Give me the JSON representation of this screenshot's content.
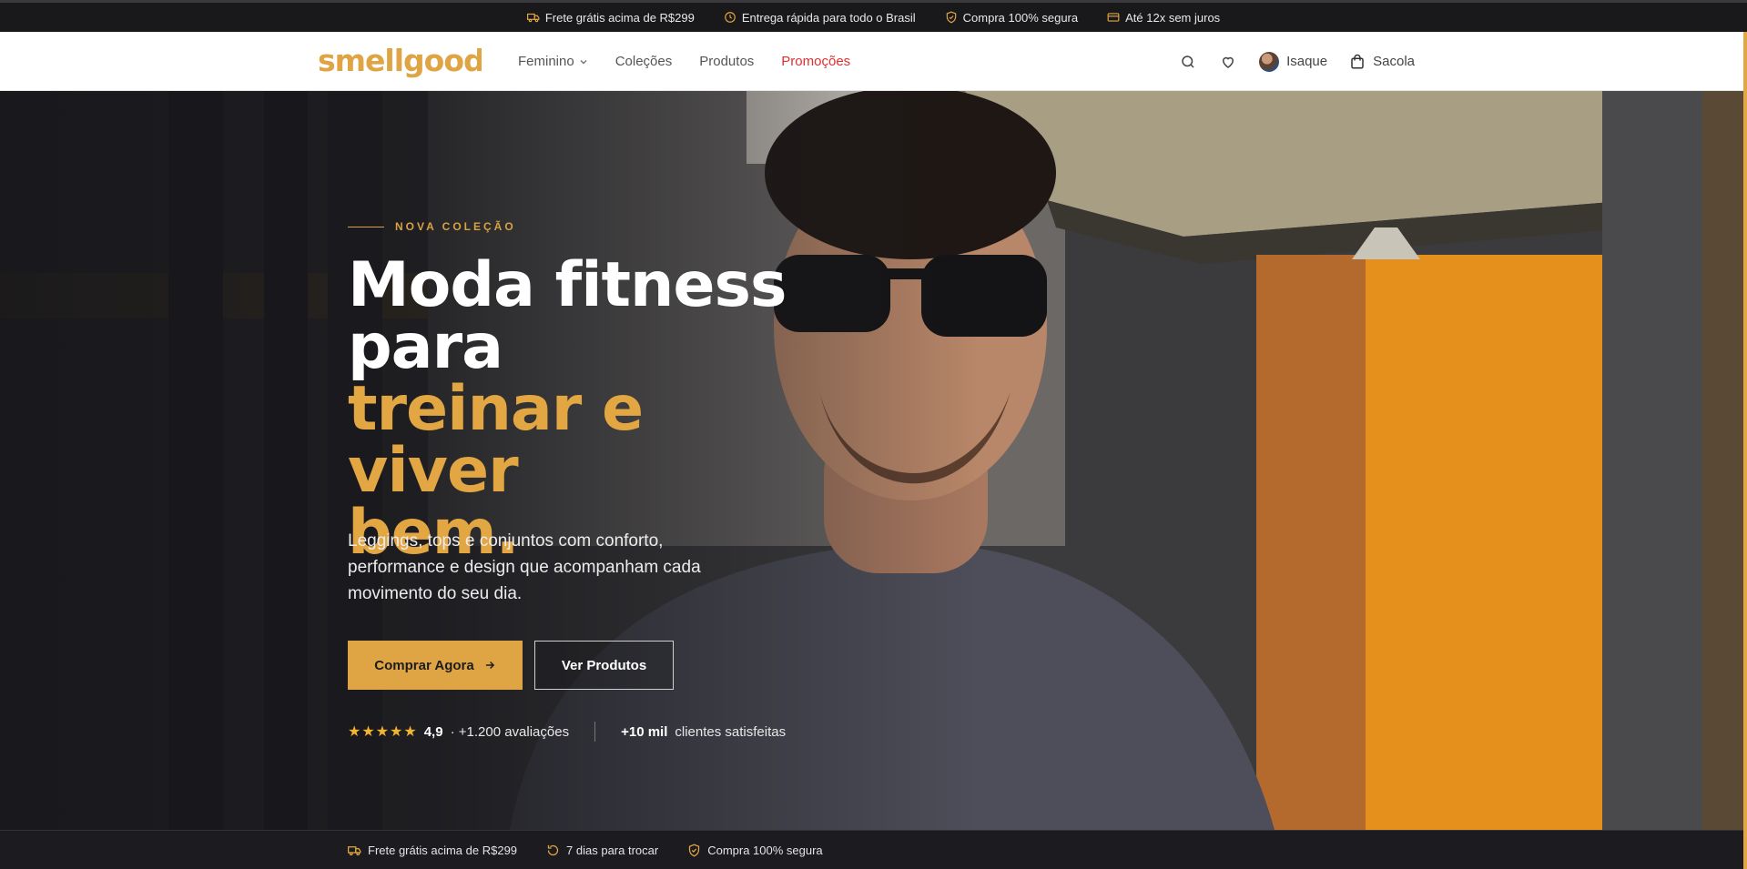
{
  "topbar": {
    "items": [
      {
        "icon": "truck-icon",
        "text": "Frete grátis acima de R$299"
      },
      {
        "icon": "clock-icon",
        "text": "Entrega rápida para todo o Brasil"
      },
      {
        "icon": "shield-check-icon",
        "text": "Compra 100% segura"
      },
      {
        "icon": "credit-card-icon",
        "text": "Até 12x sem juros"
      }
    ]
  },
  "header": {
    "logo_text": "smellgood",
    "nav": [
      {
        "label": "Feminino",
        "has_dropdown": true
      },
      {
        "label": "Coleções"
      },
      {
        "label": "Produtos"
      },
      {
        "label": "Promoções",
        "highlight_color": "#e0302f"
      }
    ],
    "user_name": "Isaque",
    "bag_label": "Sacola"
  },
  "hero": {
    "eyebrow": "NOVA COLEÇÃO",
    "headline_line1": "Moda fitness",
    "headline_line2": "para",
    "headline_line3": "treinar e viver",
    "headline_line4": "bem.",
    "subtitle": "Leggings, tops e conjuntos com conforto, performance e design que acompanham cada movimento do seu dia.",
    "primary_cta": "Comprar Agora",
    "secondary_cta": "Ver Produtos",
    "rating_value": "4,9",
    "rating_count": "· +1.200 avaliações",
    "stars": 5,
    "customers_bold": "+10 mil",
    "customers_text": "clientes satisfeitas",
    "accent_color": "#e2a642"
  },
  "bottombar": {
    "items": [
      {
        "icon": "truck-icon",
        "text": "Frete grátis acima de R$299"
      },
      {
        "icon": "refresh-icon",
        "text": "7 dias para trocar"
      },
      {
        "icon": "shield-check-icon",
        "text": "Compra 100% segura"
      }
    ]
  }
}
